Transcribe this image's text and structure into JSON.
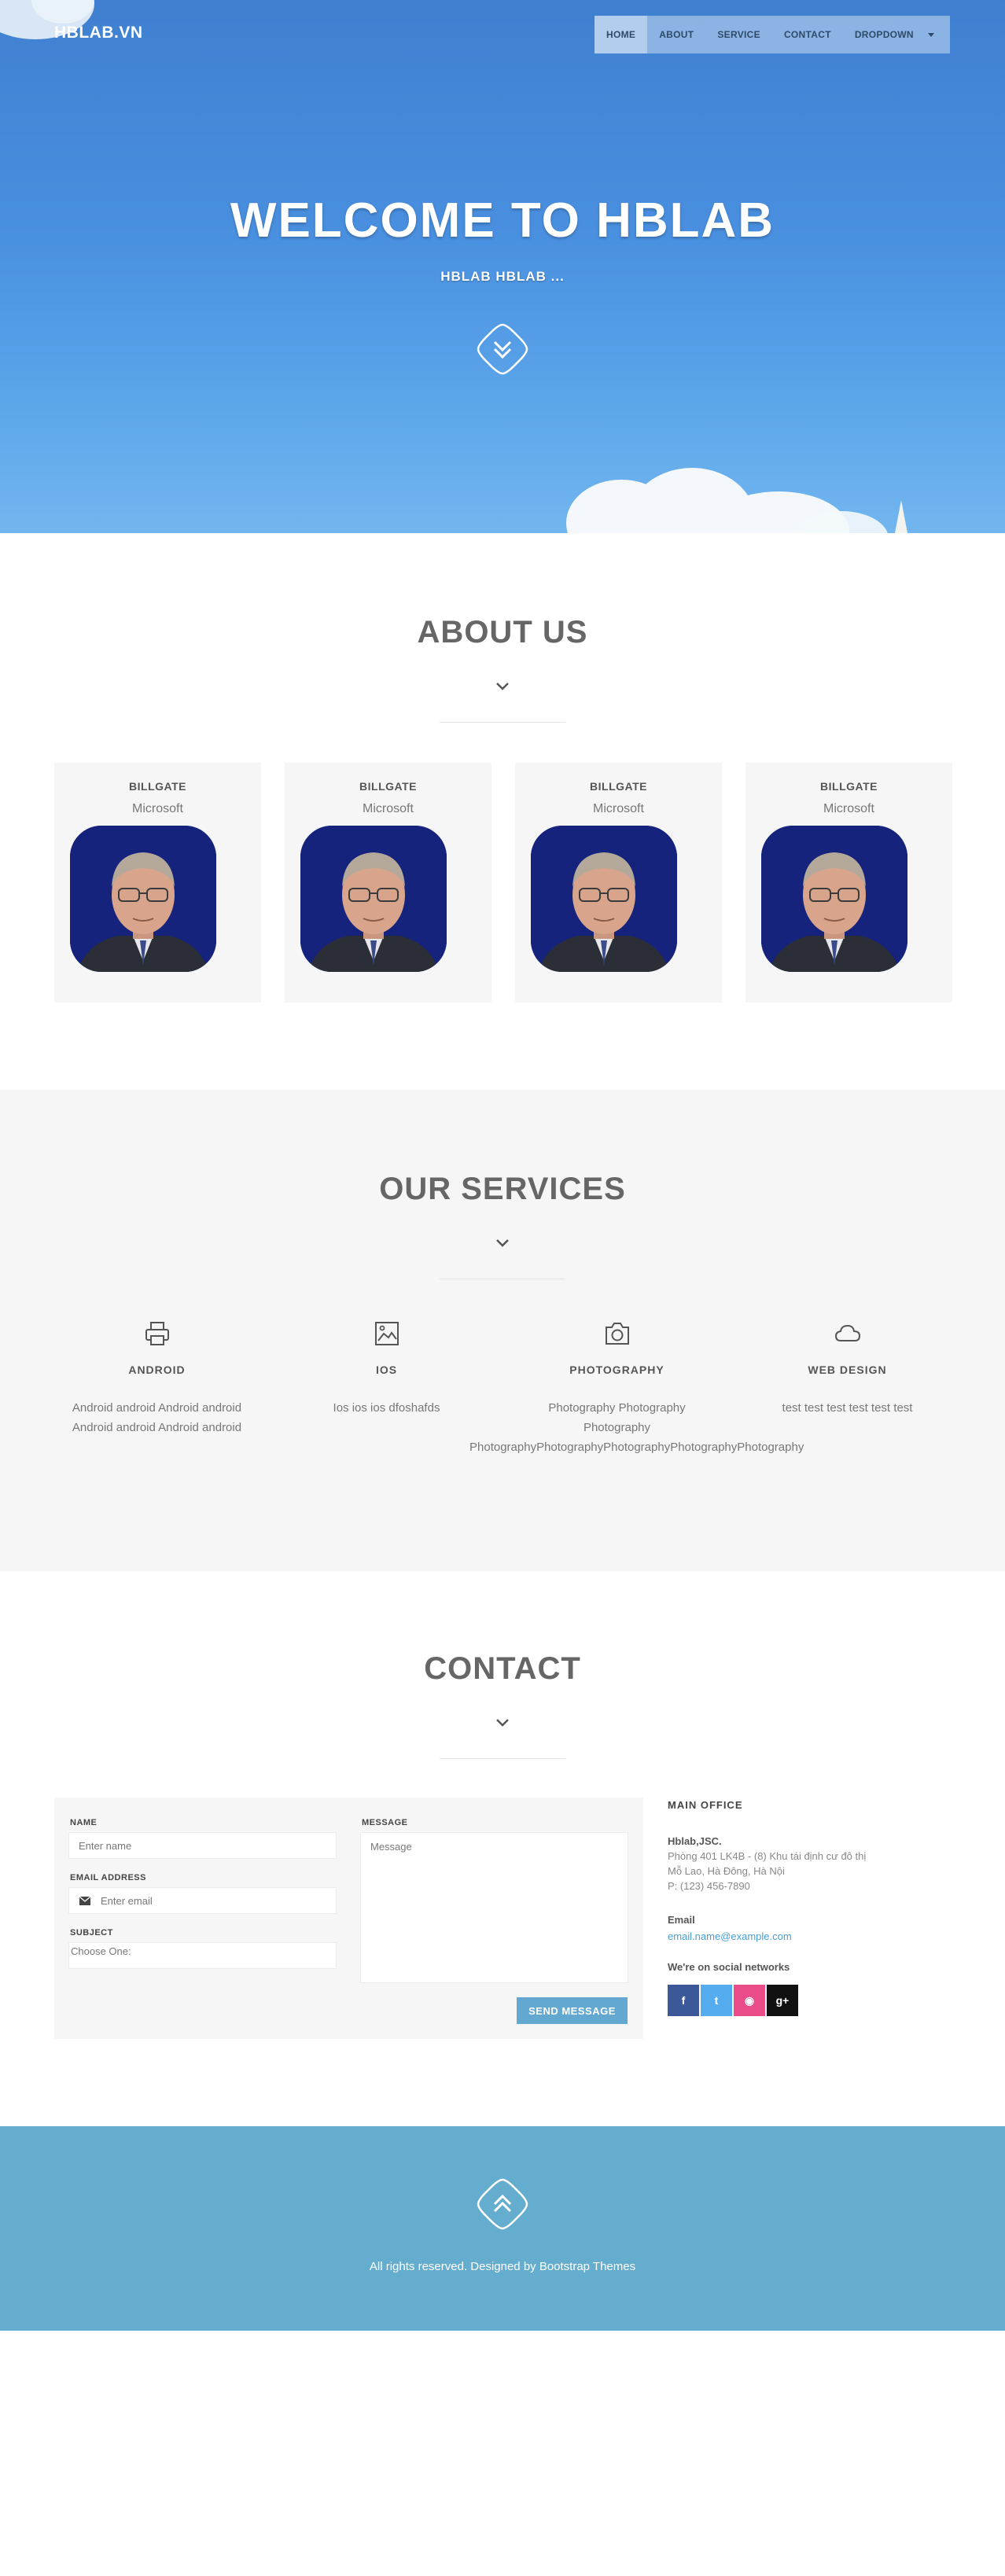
{
  "brand": "HBLAB.VN",
  "nav": {
    "items": [
      {
        "label": "HOME",
        "active": true
      },
      {
        "label": "ABOUT",
        "active": false
      },
      {
        "label": "SERVICE",
        "active": false
      },
      {
        "label": "CONTACT",
        "active": false
      },
      {
        "label": "DROPDOWN",
        "active": false
      }
    ]
  },
  "hero": {
    "title": "WELCOME TO HBLAB",
    "subtitle": "HBLAB HBLAB ..."
  },
  "about": {
    "title": "ABOUT US",
    "members": [
      {
        "name": "BILLGATE",
        "company": "Microsoft"
      },
      {
        "name": "BILLGATE",
        "company": "Microsoft"
      },
      {
        "name": "BILLGATE",
        "company": "Microsoft"
      },
      {
        "name": "BILLGATE",
        "company": "Microsoft"
      }
    ]
  },
  "services": {
    "title": "OUR SERVICES",
    "items": [
      {
        "icon": "printer-icon",
        "title": "ANDROID",
        "lines": [
          "Android android Android android",
          "Android android Android android"
        ]
      },
      {
        "icon": "image-icon",
        "title": "IOS",
        "lines": [
          "Ios ios ios dfoshafds"
        ]
      },
      {
        "icon": "camera-icon",
        "title": "PHOTOGRAPHY",
        "lines": [
          "Photography Photography",
          "Photography",
          "PhotographyPhotographyPhotographyPhotographyPhotography"
        ]
      },
      {
        "icon": "cloud-icon",
        "title": "WEB DESIGN",
        "lines": [
          "test test test test test test"
        ]
      }
    ]
  },
  "contact": {
    "title": "CONTACT",
    "form": {
      "name_label": "NAME",
      "name_placeholder": "Enter name",
      "email_label": "EMAIL ADDRESS",
      "email_placeholder": "Enter email",
      "subject_label": "SUBJECT",
      "subject_value": "Choose One:",
      "message_label": "MESSAGE",
      "message_placeholder": "Message",
      "send_label": "SEND MESSAGE"
    },
    "office": {
      "title": "MAIN OFFICE",
      "company": "Hblab,JSC.",
      "address1": "Phòng 401 LK4B - (8) Khu tái định cư đô thị",
      "address2": "Mỗ Lao, Hà Đông, Hà Nội",
      "phone": "P: (123) 456-7890",
      "email_heading": "Email",
      "email": "email.name@example.com",
      "social_heading": "We're on social networks",
      "social": [
        {
          "icon": "facebook-icon",
          "glyph": "f",
          "color": "#3b5998"
        },
        {
          "icon": "twitter-icon",
          "glyph": "t",
          "color": "#55acee"
        },
        {
          "icon": "dribbble-icon",
          "glyph": "◉",
          "color": "#ea4c89"
        },
        {
          "icon": "google-plus-icon",
          "glyph": "g+",
          "color": "#111111"
        }
      ]
    }
  },
  "footer": {
    "text": "All rights reserved. Designed by Bootstrap Themes"
  }
}
